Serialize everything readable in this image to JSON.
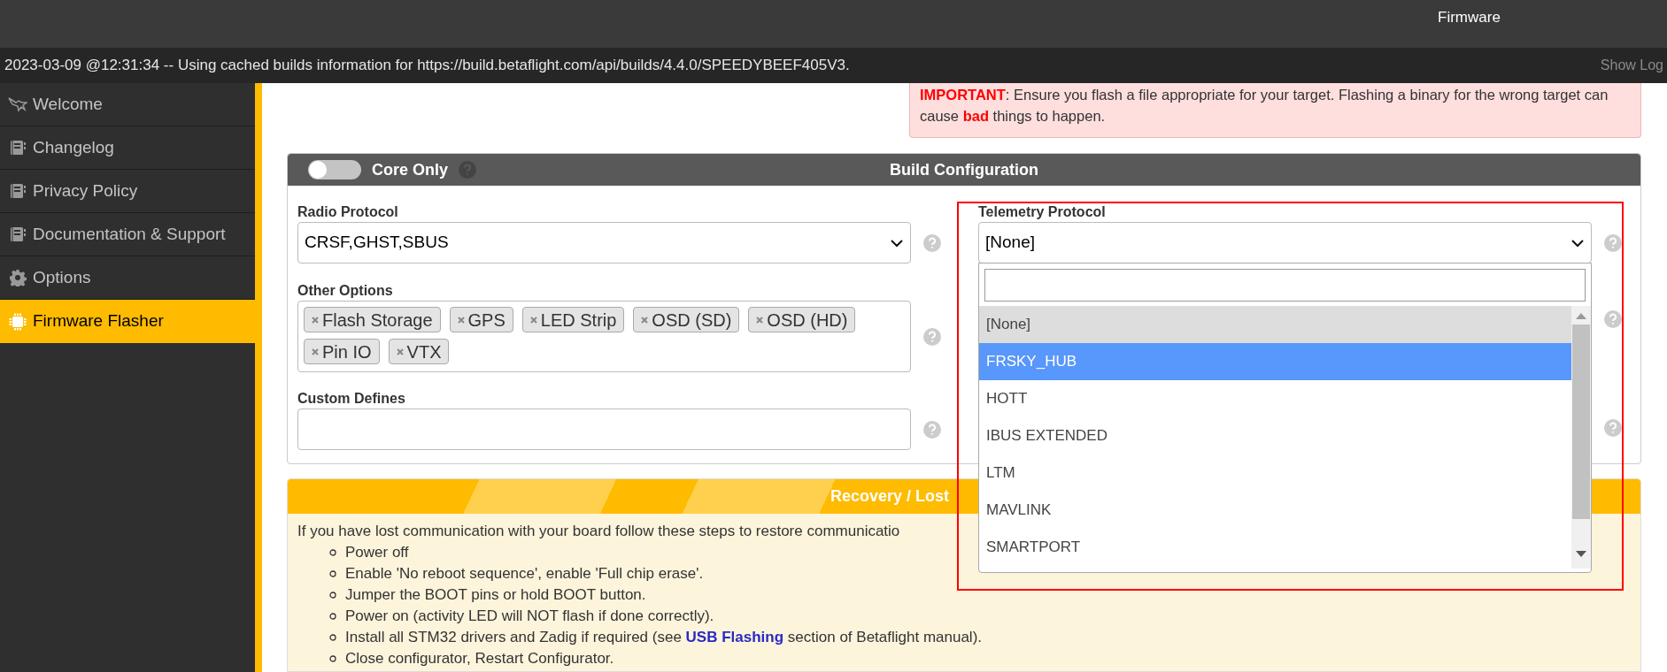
{
  "toolbar": {
    "update_button": {
      "label": "Firmware"
    }
  },
  "log": {
    "message": "2023-03-09 @12:31:34 -- Using cached builds information for https://build.betaflight.com/api/builds/4.4.0/SPEEDYBEEF405V3.",
    "show_log": "Show Log"
  },
  "sidebar": {
    "items": [
      {
        "label": "Welcome",
        "kind": "welcome",
        "selected": false
      },
      {
        "label": "Changelog",
        "kind": "document",
        "selected": false
      },
      {
        "label": "Privacy Policy",
        "kind": "document",
        "selected": false
      },
      {
        "label": "Documentation & Support",
        "kind": "document",
        "selected": false
      },
      {
        "label": "Options",
        "kind": "gear",
        "selected": false
      },
      {
        "label": "Firmware Flasher",
        "kind": "chip",
        "selected": true
      }
    ]
  },
  "warning": {
    "text": "**IMPORTANT**: Ensure you flash a file appropriate for your target. Flashing a binary for the wrong target can cause **bad** things to happen."
  },
  "build_config": {
    "title": "Build Configuration",
    "core_only": {
      "label": "Core Only",
      "on": false
    },
    "radio_protocol": {
      "label": "Radio Protocol",
      "value": "CRSF,GHST,SBUS"
    },
    "other_options": {
      "label": "Other Options",
      "tags": [
        "Flash Storage",
        "GPS",
        "LED Strip",
        "OSD (SD)",
        "OSD (HD)",
        "Pin IO",
        "VTX"
      ]
    },
    "custom_defines": {
      "label": "Custom Defines"
    },
    "telemetry_protocol": {
      "label": "Telemetry Protocol",
      "value": "[None]",
      "options": [
        {
          "label": "[None]",
          "selected": true,
          "highlighted": false
        },
        {
          "label": "FRSKY_HUB",
          "selected": false,
          "highlighted": true
        },
        {
          "label": "HOTT",
          "selected": false,
          "highlighted": false
        },
        {
          "label": "IBUS EXTENDED",
          "selected": false,
          "highlighted": false
        },
        {
          "label": "LTM",
          "selected": false,
          "highlighted": false
        },
        {
          "label": "MAVLINK",
          "selected": false,
          "highlighted": false
        },
        {
          "label": "SMARTPORT",
          "selected": false,
          "highlighted": false
        }
      ]
    }
  },
  "recovery": {
    "title": "Recovery / Lost",
    "intro": "If you have lost communication with your board follow these steps to restore communicatio",
    "steps": [
      {
        "text": "Power off"
      },
      {
        "text": "Enable 'No reboot sequence', enable 'Full chip erase'."
      },
      {
        "text": "Jumper the BOOT pins or hold BOOT button."
      },
      {
        "text": "Power on (activity LED will NOT flash if done correctly)."
      },
      {
        "text": "Install all STM32 drivers and Zadig if required (see ",
        "link": "USB Flashing",
        "after": " section of Betaflight manual)."
      },
      {
        "text": "Close configurator, Restart Configurator."
      }
    ]
  }
}
